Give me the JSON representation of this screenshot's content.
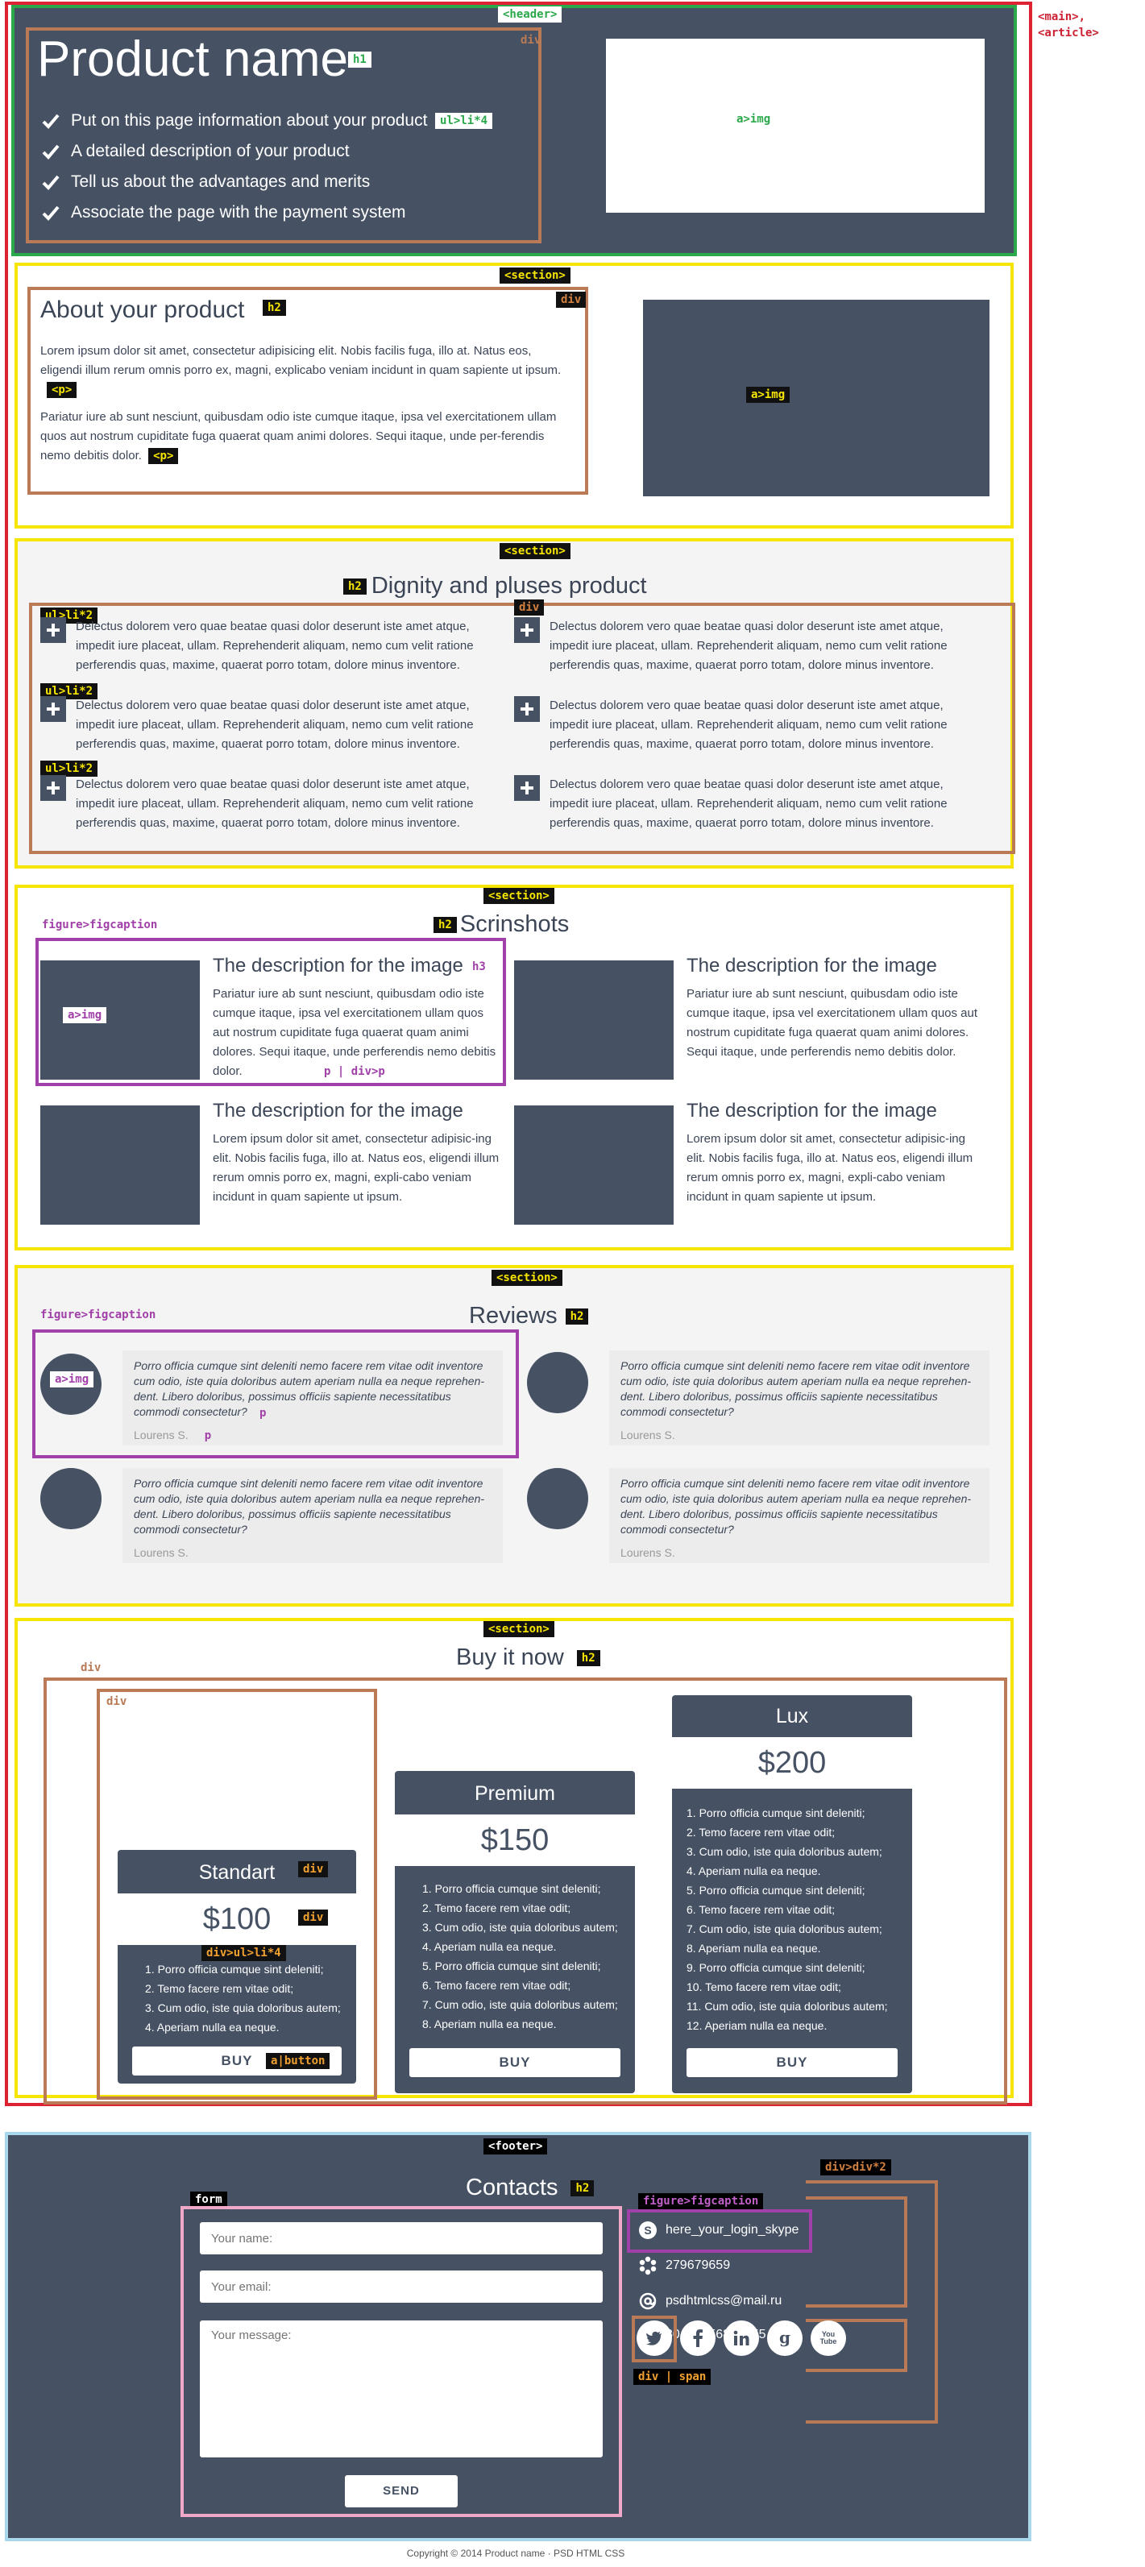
{
  "annotations": {
    "header": "<header>",
    "main_article": [
      "<main>,",
      "<article>"
    ],
    "h1": "h1",
    "div": "div",
    "ul_li4": "ul>li*4",
    "a_img": "a>img",
    "section": "<section>",
    "h2": "h2",
    "p": "<p>",
    "ul_li2": "ul>li*2",
    "figure_figcaption": "figure>figcaption",
    "h3": "h3",
    "p_div_p": "p | div>p",
    "p_small": "p",
    "div_ul_li4": "div>ul>li*4",
    "a_button": "a|button",
    "footer": "<footer>",
    "form": "form",
    "div_div2": "div>div*2",
    "div_span": "div | span"
  },
  "header": {
    "title": "Product name",
    "bullets": [
      "Put on this page information about your product",
      "A detailed description of your product",
      "Tell us about the advantages and merits",
      "Associate the page with the payment system"
    ]
  },
  "about": {
    "title": "About your product",
    "paragraphs": [
      "Lorem ipsum dolor sit amet, consectetur adipisicing elit. Nobis facilis fuga, illo at. Natus eos, eligendi illum rerum omnis porro ex, magni, explicabo veniam incidunt in quam sapiente ut ipsum.",
      "Pariatur iure ab sunt nesciunt, quibusdam odio iste cumque itaque, ipsa vel exercitationem ullam quos aut nostrum cupiditate fuga quaerat quam animi dolores. Sequi itaque, unde per-ferendis nemo debitis dolor."
    ]
  },
  "dignity": {
    "title": "Dignity and pluses product",
    "item_text": "Delectus dolorem vero quae beatae quasi dolor deserunt iste amet atque, impedit iure placeat, ullam. Reprehenderit aliquam, nemo cum velit ratione perferendis quas, maxime, quaerat porro totam, dolore minus inventore."
  },
  "screenshots": {
    "title": "Scrinshots",
    "items": [
      {
        "title": "The description for the image",
        "text": "Pariatur iure ab sunt nesciunt, quibusdam odio iste cumque itaque, ipsa vel exercitationem ullam quos aut nostrum cupiditate fuga quaerat quam animi dolores. Sequi itaque, unde perferendis nemo debitis dolor."
      },
      {
        "title": "The description for the image",
        "text": "Pariatur iure ab sunt nesciunt, quibusdam odio iste cumque itaque, ipsa vel exercitationem ullam quos aut nostrum cupiditate fuga quaerat quam animi dolores. Sequi itaque, unde perferendis nemo debitis dolor."
      },
      {
        "title": "The description for the image",
        "text": "Lorem ipsum dolor sit amet, consectetur adipisic-ing elit. Nobis facilis fuga, illo at. Natus eos, eligendi illum rerum omnis porro ex, magni, expli-cabo veniam incidunt in quam sapiente ut ipsum."
      },
      {
        "title": "The description for the image",
        "text": "Lorem ipsum dolor sit amet, consectetur adipisic-ing elit. Nobis facilis fuga, illo at. Natus eos, eligendi illum rerum omnis porro ex, magni, expli-cabo veniam incidunt in quam sapiente ut ipsum."
      }
    ]
  },
  "reviews": {
    "title": "Reviews",
    "text": "Porro officia cumque sint deleniti nemo facere rem vitae odit inventore cum odio, iste quia doloribus autem aperiam nulla ea neque reprehen-dent. Libero doloribus, possimus officiis sapiente necessitatibus commodi consectetur?",
    "author": "Lourens S."
  },
  "buy": {
    "title": "Buy it now",
    "button": "BUY",
    "plans": [
      {
        "name": "Standart",
        "price": "$100",
        "items": [
          "1. Porro officia cumque sint deleniti;",
          "2. Temo facere rem vitae odit;",
          "3. Cum odio, iste quia doloribus autem;",
          "4. Aperiam nulla ea neque."
        ]
      },
      {
        "name": "Premium",
        "price": "$150",
        "items": [
          "1. Porro officia cumque sint deleniti;",
          "2. Temo facere rem vitae odit;",
          "3. Cum odio, iste quia doloribus autem;",
          "4. Aperiam nulla ea neque.",
          "5. Porro officia cumque sint deleniti;",
          "6. Temo facere rem vitae odit;",
          "7. Cum odio, iste quia doloribus autem;",
          "8. Aperiam nulla ea neque."
        ]
      },
      {
        "name": "Lux",
        "price": "$200",
        "items": [
          "1. Porro officia cumque sint deleniti;",
          "2. Temo facere rem vitae odit;",
          "3. Cum odio, iste quia doloribus autem;",
          "4. Aperiam nulla ea neque.",
          "5. Porro officia cumque sint deleniti;",
          "6. Temo facere rem vitae odit;",
          "7. Cum odio, iste quia doloribus autem;",
          "8. Aperiam nulla ea neque.",
          "9. Porro officia cumque sint deleniti;",
          "10. Temo facere rem vitae odit;",
          "11. Cum odio, iste quia doloribus autem;",
          "12. Aperiam nulla ea neque."
        ]
      }
    ]
  },
  "footer": {
    "title": "Contacts",
    "name_placeholder": "Your name:",
    "email_placeholder": "Your email:",
    "message_placeholder": "Your message:",
    "send": "SEND",
    "skype": "here_your_login_skype",
    "icq": "279679659",
    "email": "psdhtmlcss@mail.ru",
    "phone": "80 00 4568 55 55",
    "youtube_lines": [
      "You",
      "Tube"
    ],
    "copyright": "Copyright © 2014 Product name · PSD HTML CSS"
  },
  "colors": {
    "slate": "#465264",
    "red": "#dd2233",
    "green": "#2aa84a",
    "yellow": "#f5e500",
    "brown": "#b97a55",
    "purple": "#a040a8",
    "lightblue": "#a8d8ea",
    "pink": "#f0a8c8"
  }
}
